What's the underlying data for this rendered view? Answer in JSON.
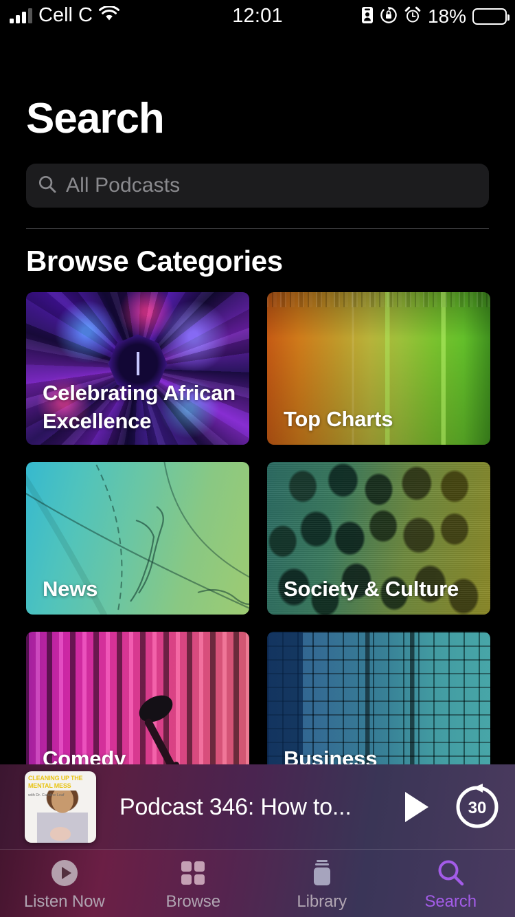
{
  "status_bar": {
    "carrier": "Cell C",
    "signal_icon": "cellular-bars-icon",
    "wifi_icon": "wifi-icon",
    "time": "12:01",
    "icons": [
      "id-badge-icon",
      "rotation-lock-icon",
      "alarm-clock-icon"
    ],
    "battery_percent": "18%",
    "battery_level": 18,
    "battery_color": "#ff3b30"
  },
  "header": {
    "title": "Search"
  },
  "search": {
    "placeholder": "All Podcasts",
    "value": "",
    "icon": "search-icon"
  },
  "browse": {
    "section_title": "Browse Categories",
    "categories": [
      {
        "label": "Celebrating African Excellence",
        "art": "kaleidoscope"
      },
      {
        "label": "Top Charts",
        "art": "bar-chart"
      },
      {
        "label": "News",
        "art": "map"
      },
      {
        "label": "Society & Culture",
        "art": "crowd"
      },
      {
        "label": "Comedy",
        "art": "stage-curtain-microphone"
      },
      {
        "label": "Business",
        "art": "office-building"
      }
    ]
  },
  "now_playing": {
    "episode_title": "Podcast 346: How to...",
    "artwork": {
      "show_title": "CLEANING UP THE MENTAL MESS",
      "host_line": "with Dr. Caroline Leaf"
    },
    "play_icon": "play-icon",
    "skip_icon": "skip-forward-30-icon",
    "skip_seconds": "30"
  },
  "tab_bar": {
    "active_color": "#a35ce8",
    "inactive_color": "#b0a5b2",
    "tabs": [
      {
        "label": "Listen Now",
        "icon": "play-circle-icon",
        "active": false
      },
      {
        "label": "Browse",
        "icon": "grid-squares-icon",
        "active": false
      },
      {
        "label": "Library",
        "icon": "library-stack-icon",
        "active": false
      },
      {
        "label": "Search",
        "icon": "search-icon",
        "active": true
      }
    ]
  }
}
